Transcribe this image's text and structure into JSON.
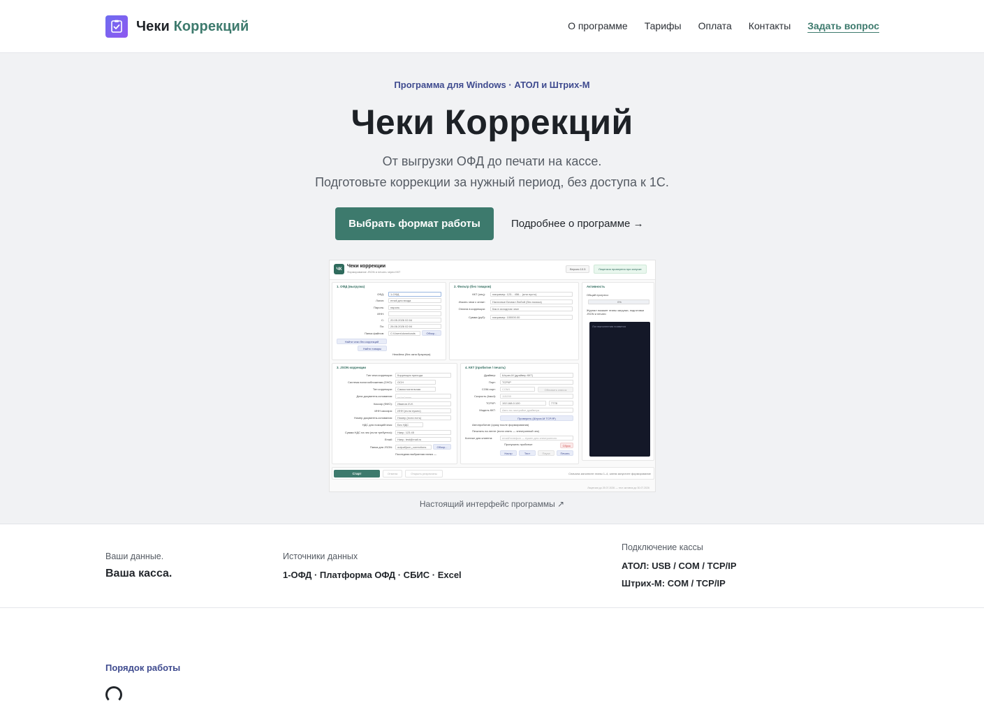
{
  "header": {
    "brand_part1": "Чеки",
    "brand_part2": "Коррекций",
    "nav": [
      "О программе",
      "Тарифы",
      "Оплата",
      "Контакты"
    ],
    "ask_link": "Задать вопрос"
  },
  "hero": {
    "eyebrow": "Программа для Windows · АТОЛ и Штрих-М",
    "title": "Чеки Коррекций",
    "subtitle_line1": "От выгрузки ОФД до печати на кассе.",
    "subtitle_line2": "Подготовьте коррекции за нужный период, без доступа к 1С.",
    "primary_button": "Выбрать формат работы",
    "secondary_link": "Подробнее о программе  →",
    "caption": "Настоящий интерфейс программы ↗"
  },
  "mock": {
    "badge": "ЧК",
    "title": "Чеки коррекции",
    "subtitle": "Формирование JSON и печать через ККТ",
    "version": "Версия 10.5",
    "license": "Лицензия проверена при запуске",
    "p1_title": "1. ОФД (выгрузка)",
    "p1_labels": [
      "ОФД:",
      "Логин:",
      "Пароль:",
      "ИНН:",
      "С:",
      "По:",
      "Папка файлов:"
    ],
    "p1_values": [
      "1-ОФД",
      "email для входа",
      "пароль",
      "",
      "20.05.2026 02:04",
      "26.06.2026 02:04",
      "C:\\Users\\downloads"
    ],
    "p1_btn1": "Найти чеки без коррекций",
    "p1_btn2": "Найти товары",
    "p1_browse": "Обзор...",
    "p1_headless": "Headless (без окна браузера)",
    "p2_title": "2. Фильтр (без товаров)",
    "p2_labels": [
      "ККТ (опц):",
      "Искать чеки с оплат:",
      "Оплата в коррекции:",
      "Сумма (руб):"
    ],
    "p2_values": [
      "например: 123... 456... (или пусто)",
      "Наличные     Безнал     Любой (без поиска)",
      "Как в исходном чеке",
      "например: 100000.00"
    ],
    "p3_title": "Активность",
    "p3_progress_label": "Общий прогресс:",
    "p3_progress_value": "0%",
    "p3_note": "Журнал покажет этапы загрузки, подготовки JSON и печати",
    "console_text": "Лог выполнения появится",
    "p4_title": "3. JSON коррекции",
    "p4_labels": [
      "Тип чека коррекции:",
      "Система налогообложения (СНО):",
      "Тип коррекции:",
      "Дата документа-основания:",
      "Кассир (ФИО):",
      "ИНН кассира:",
      "Номер документа-основания:",
      "НДС для позиций/чека:",
      "Сумма НДС на чек (если требуется):",
      "Email:",
      "Папка для JSON:"
    ],
    "p4_values": [
      "Коррекция прихода",
      "ОСН",
      "Самостоятельная",
      "__.__.____",
      "Иванов И.И.",
      "ИНН (если нужно)",
      "Номер (если есть)",
      "Без НДС",
      "Напр. 123.45",
      "Напр. test@mail.ru",
      "output\\json_corrections"
    ],
    "p4_browse": "Обзор...",
    "p4_last": "Последняя выбранная папка —",
    "p5_title": "4. ККТ (пробитие / печать)",
    "p5_labels": [
      "Драйвер:",
      "Порт:",
      "COM-порт:",
      "Скорость (baud):",
      "TCP/IP:",
      "Модель ККТ:"
    ],
    "p5_values": [
      "Штрих-М (драйвер ККТ)",
      "TCP/IP",
      "COM1",
      "115200",
      "192.168.0.100",
      "Авто по настройке драйвера"
    ],
    "p5_port": "7778",
    "p5_refresh": "Обновить список",
    "p5_check": "Проверить (Штрих-М TCP/IP)",
    "p5_auto": "Автопробитие (сразу после формирования)",
    "p5_print": "Печатать на ленте (если снять — электронный чек)",
    "p5_contact_label": "Контакт для клиента:",
    "p5_contact": "email/телефон — нужен для электронного",
    "p5_skip": "Пропускать пробитые",
    "p5_clear": "Сброс",
    "p5_btns": [
      "Настр",
      "Тест",
      "Пауза",
      "Печать"
    ],
    "start": "Старт",
    "cancel": "Отмена",
    "open_results": "Открыть результаты",
    "bottom_note": "Сначала заполните этапы 1–4, затем запустите формирование",
    "footer_note": "Лицензия до 25.07.2026 — тест-активна до 30.07.2026"
  },
  "stats": {
    "col1_label": "Ваши данные.",
    "col1_value": "Ваша касса.",
    "col2_label": "Источники данных",
    "col2_value": "1-ОФД · Платформа ОФД · СБИС · Excel",
    "col3_label": "Подключение кассы",
    "col3_value1": "АТОЛ: USB / COM / TCP/IP",
    "col3_value2": "Штрих-М: COM / TCP/IP"
  },
  "section": {
    "title": "Порядок работы"
  },
  "colors": {
    "accent": "#3d7a6d",
    "indigo": "#3f4b8f",
    "hero_bg": "#f1f2f4"
  }
}
